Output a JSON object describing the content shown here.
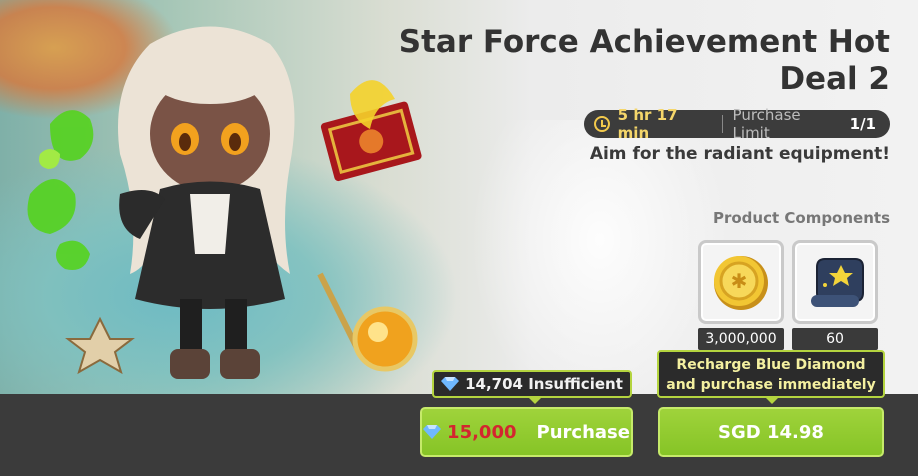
{
  "product": {
    "title": "Star Force Achievement Hot Deal 2",
    "timer": "5 hr 17 min",
    "purchase_limit_label": "Purchase Limit",
    "purchase_limit_value": "1/1",
    "subtitle": "Aim for the radiant equipment!"
  },
  "components": {
    "label": "Product Components",
    "items": [
      {
        "icon": "gold-coin-icon",
        "quantity": "3,000,000"
      },
      {
        "icon": "star-scroll-icon",
        "quantity": "60"
      }
    ]
  },
  "purchase": {
    "balance_text": "14,704 Insufficient",
    "price": "15,000",
    "button_label": "Purchase"
  },
  "recharge": {
    "tip_line1": "Recharge Blue Diamond",
    "tip_line2": "and purchase immediately",
    "button_label": "SGD 14.98"
  },
  "colors": {
    "button_green": "#8cc92a",
    "tooltip_border": "#b4d43f",
    "price_red": "#d3262f",
    "timer_yellow": "#f5d66a"
  }
}
